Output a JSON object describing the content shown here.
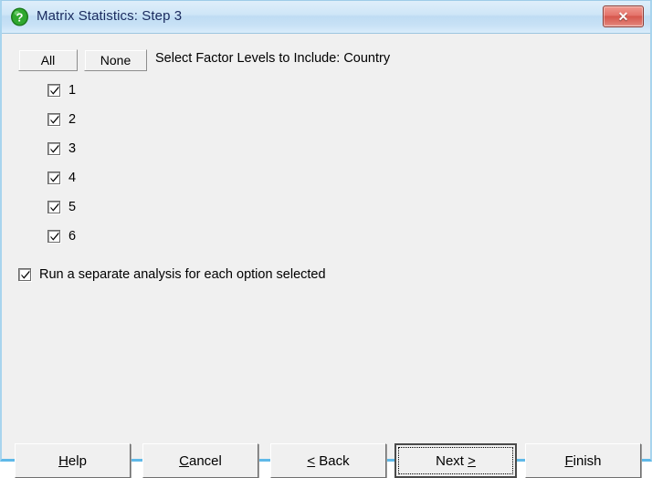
{
  "window": {
    "title": "Matrix Statistics: Step 3",
    "icon": "question-mark-icon",
    "close_label": "✕",
    "title_color": "#1a2a5e",
    "accent_color": "#5fb9e8"
  },
  "toolbar": {
    "all_label": "All",
    "none_label": "None",
    "instruction": "Select Factor Levels to Include: Country"
  },
  "factor_levels": {
    "items": [
      {
        "label": "1",
        "checked": true
      },
      {
        "label": "2",
        "checked": true
      },
      {
        "label": "3",
        "checked": true
      },
      {
        "label": "4",
        "checked": true
      },
      {
        "label": "5",
        "checked": true
      },
      {
        "label": "6",
        "checked": true
      }
    ]
  },
  "separate_analysis": {
    "label": "Run a separate analysis for each option selected",
    "checked": true
  },
  "footer": {
    "help": {
      "prefix": "",
      "accel": "H",
      "suffix": "elp"
    },
    "cancel": {
      "prefix": "",
      "accel": "C",
      "suffix": "ancel"
    },
    "back": {
      "prefix": "",
      "accel": "<",
      "suffix": " Back"
    },
    "next": {
      "prefix": "Next ",
      "accel": ">",
      "suffix": "",
      "is_default": true
    },
    "finish": {
      "prefix": "F",
      "accel": "i",
      "suffix": "nish"
    }
  }
}
